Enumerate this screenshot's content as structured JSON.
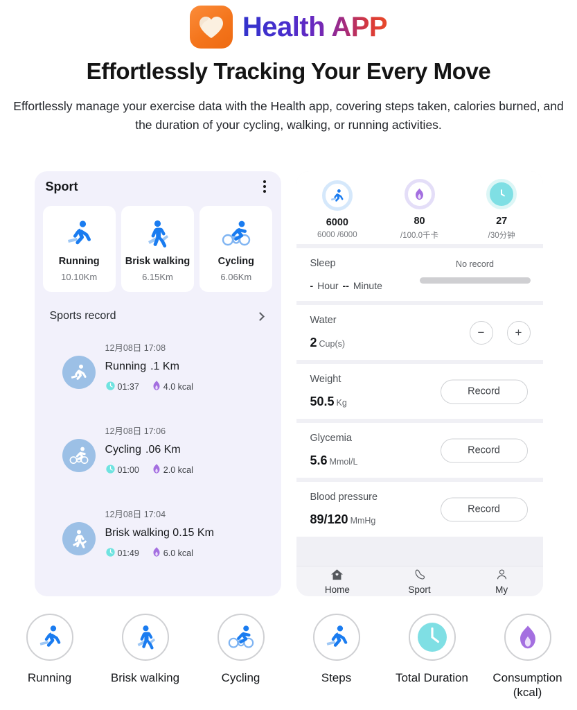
{
  "header": {
    "logo_icon": "heart-icon",
    "brand_part1": "Health",
    "brand_part2": "APP",
    "headline": "Effortlessly Tracking Your Every Move",
    "description": "Effortlessly manage your exercise data with the Health app, covering steps taken, calories burned, and the duration of your cycling, walking, or running activities."
  },
  "left_phone": {
    "title": "Sport",
    "menu_icon": "kebab-menu-icon",
    "sport_cards": [
      {
        "icon": "running-icon",
        "name": "Running",
        "distance": "10.10Km"
      },
      {
        "icon": "walking-icon",
        "name": "Brisk walking",
        "distance": "6.15Km"
      },
      {
        "icon": "cycling-icon",
        "name": "Cycling",
        "distance": "6.06Km"
      }
    ],
    "records_label": "Sports record",
    "records_chevron": "chevron-right-icon",
    "records": [
      {
        "icon": "running-icon",
        "time": "12月08日 17:08",
        "activity": "Running",
        "distance": ".1 Km",
        "duration": "01:37",
        "calories": "4.0 kcal"
      },
      {
        "icon": "cycling-icon",
        "time": "12月08日 17:06",
        "activity": "Cycling",
        "distance": ".06 Km",
        "duration": "01:00",
        "calories": "2.0 kcal"
      },
      {
        "icon": "walking-icon",
        "time": "12月08日 17:04",
        "activity": "Brisk walking 0.15",
        "distance": "Km",
        "duration": "01:49",
        "calories": "6.0 kcal"
      }
    ]
  },
  "right_phone": {
    "metrics": [
      {
        "icon": "running-icon",
        "value": "6000",
        "sub": "6000 /6000"
      },
      {
        "icon": "flame-icon",
        "value": "80",
        "sub": "/100.0千卡"
      },
      {
        "icon": "clock-icon",
        "value": "27",
        "sub": "/30分钟"
      }
    ],
    "sleep": {
      "label": "Sleep",
      "hour_value": "-",
      "hour_unit": "Hour",
      "minute_value": "--",
      "minute_unit": "Minute",
      "status": "No record"
    },
    "water": {
      "label": "Water",
      "value": "2",
      "unit": "Cup(s)",
      "minus_label": "−",
      "plus_label": "+"
    },
    "weight": {
      "label": "Weight",
      "value": "50.5",
      "unit": "Kg",
      "button": "Record"
    },
    "glycemia": {
      "label": "Glycemia",
      "value": "5.6",
      "unit": "Mmol/L",
      "button": "Record"
    },
    "blood_pressure": {
      "label": "Blood pressure",
      "value": "89/120",
      "unit": "MmHg",
      "button": "Record"
    },
    "tabs": [
      {
        "icon": "home-icon",
        "label": "Home"
      },
      {
        "icon": "shoe-icon",
        "label": "Sport"
      },
      {
        "icon": "person-icon",
        "label": "My"
      }
    ]
  },
  "legend": [
    {
      "icon": "running-icon",
      "label": "Running"
    },
    {
      "icon": "walking-icon",
      "label": "Brisk walking"
    },
    {
      "icon": "cycling-icon",
      "label": "Cycling"
    },
    {
      "icon": "running-icon",
      "label": "Steps"
    },
    {
      "icon": "clock-icon",
      "label": "Total Duration"
    },
    {
      "icon": "flame-icon",
      "label": "Consumption (kcal)"
    }
  ],
  "colors": {
    "brand_orange": "#f4751c",
    "accent_blue": "#1a7cf0",
    "light_blue": "#9cc0e6",
    "cyan": "#7fdfe4",
    "purple": "#a46fe0",
    "panel_left_bg": "#f2f1fb",
    "panel_right_bg": "#f0f0f5"
  }
}
